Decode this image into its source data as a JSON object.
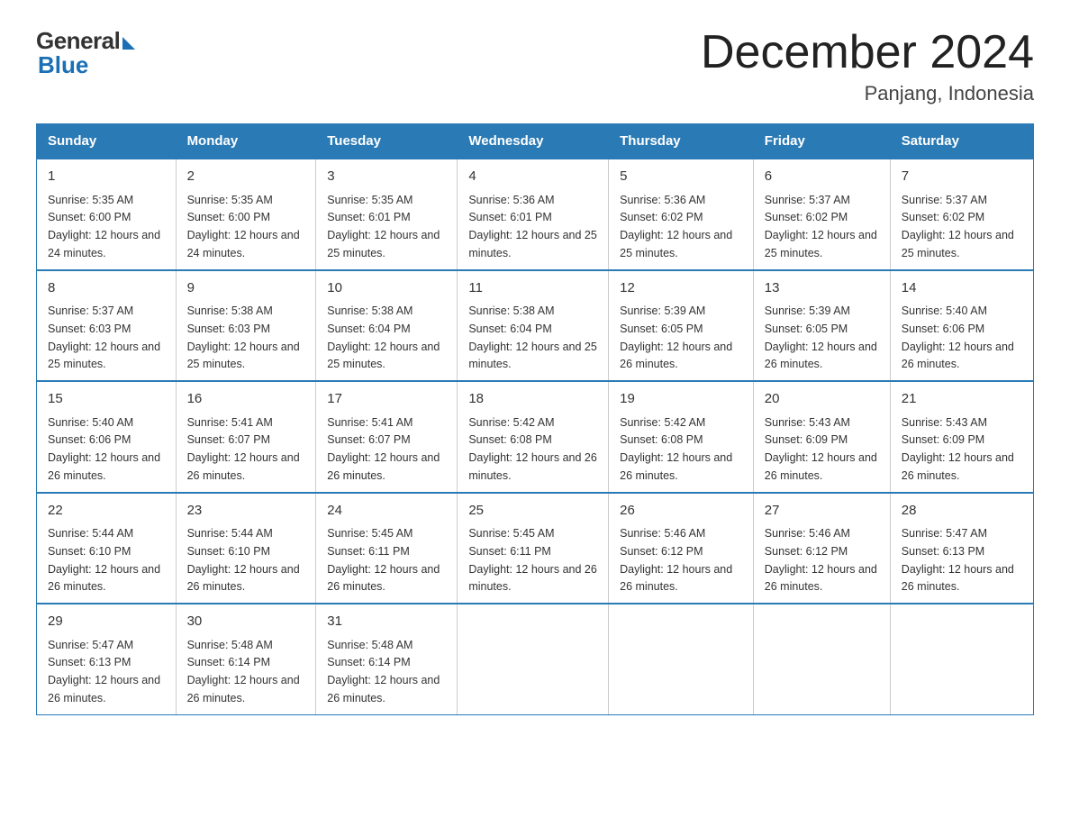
{
  "header": {
    "logo_general": "General",
    "logo_blue": "Blue",
    "main_title": "December 2024",
    "subtitle": "Panjang, Indonesia"
  },
  "days_of_week": [
    "Sunday",
    "Monday",
    "Tuesday",
    "Wednesday",
    "Thursday",
    "Friday",
    "Saturday"
  ],
  "weeks": [
    [
      {
        "day": "1",
        "sunrise": "5:35 AM",
        "sunset": "6:00 PM",
        "daylight": "12 hours and 24 minutes."
      },
      {
        "day": "2",
        "sunrise": "5:35 AM",
        "sunset": "6:00 PM",
        "daylight": "12 hours and 24 minutes."
      },
      {
        "day": "3",
        "sunrise": "5:35 AM",
        "sunset": "6:01 PM",
        "daylight": "12 hours and 25 minutes."
      },
      {
        "day": "4",
        "sunrise": "5:36 AM",
        "sunset": "6:01 PM",
        "daylight": "12 hours and 25 minutes."
      },
      {
        "day": "5",
        "sunrise": "5:36 AM",
        "sunset": "6:02 PM",
        "daylight": "12 hours and 25 minutes."
      },
      {
        "day": "6",
        "sunrise": "5:37 AM",
        "sunset": "6:02 PM",
        "daylight": "12 hours and 25 minutes."
      },
      {
        "day": "7",
        "sunrise": "5:37 AM",
        "sunset": "6:02 PM",
        "daylight": "12 hours and 25 minutes."
      }
    ],
    [
      {
        "day": "8",
        "sunrise": "5:37 AM",
        "sunset": "6:03 PM",
        "daylight": "12 hours and 25 minutes."
      },
      {
        "day": "9",
        "sunrise": "5:38 AM",
        "sunset": "6:03 PM",
        "daylight": "12 hours and 25 minutes."
      },
      {
        "day": "10",
        "sunrise": "5:38 AM",
        "sunset": "6:04 PM",
        "daylight": "12 hours and 25 minutes."
      },
      {
        "day": "11",
        "sunrise": "5:38 AM",
        "sunset": "6:04 PM",
        "daylight": "12 hours and 25 minutes."
      },
      {
        "day": "12",
        "sunrise": "5:39 AM",
        "sunset": "6:05 PM",
        "daylight": "12 hours and 26 minutes."
      },
      {
        "day": "13",
        "sunrise": "5:39 AM",
        "sunset": "6:05 PM",
        "daylight": "12 hours and 26 minutes."
      },
      {
        "day": "14",
        "sunrise": "5:40 AM",
        "sunset": "6:06 PM",
        "daylight": "12 hours and 26 minutes."
      }
    ],
    [
      {
        "day": "15",
        "sunrise": "5:40 AM",
        "sunset": "6:06 PM",
        "daylight": "12 hours and 26 minutes."
      },
      {
        "day": "16",
        "sunrise": "5:41 AM",
        "sunset": "6:07 PM",
        "daylight": "12 hours and 26 minutes."
      },
      {
        "day": "17",
        "sunrise": "5:41 AM",
        "sunset": "6:07 PM",
        "daylight": "12 hours and 26 minutes."
      },
      {
        "day": "18",
        "sunrise": "5:42 AM",
        "sunset": "6:08 PM",
        "daylight": "12 hours and 26 minutes."
      },
      {
        "day": "19",
        "sunrise": "5:42 AM",
        "sunset": "6:08 PM",
        "daylight": "12 hours and 26 minutes."
      },
      {
        "day": "20",
        "sunrise": "5:43 AM",
        "sunset": "6:09 PM",
        "daylight": "12 hours and 26 minutes."
      },
      {
        "day": "21",
        "sunrise": "5:43 AM",
        "sunset": "6:09 PM",
        "daylight": "12 hours and 26 minutes."
      }
    ],
    [
      {
        "day": "22",
        "sunrise": "5:44 AM",
        "sunset": "6:10 PM",
        "daylight": "12 hours and 26 minutes."
      },
      {
        "day": "23",
        "sunrise": "5:44 AM",
        "sunset": "6:10 PM",
        "daylight": "12 hours and 26 minutes."
      },
      {
        "day": "24",
        "sunrise": "5:45 AM",
        "sunset": "6:11 PM",
        "daylight": "12 hours and 26 minutes."
      },
      {
        "day": "25",
        "sunrise": "5:45 AM",
        "sunset": "6:11 PM",
        "daylight": "12 hours and 26 minutes."
      },
      {
        "day": "26",
        "sunrise": "5:46 AM",
        "sunset": "6:12 PM",
        "daylight": "12 hours and 26 minutes."
      },
      {
        "day": "27",
        "sunrise": "5:46 AM",
        "sunset": "6:12 PM",
        "daylight": "12 hours and 26 minutes."
      },
      {
        "day": "28",
        "sunrise": "5:47 AM",
        "sunset": "6:13 PM",
        "daylight": "12 hours and 26 minutes."
      }
    ],
    [
      {
        "day": "29",
        "sunrise": "5:47 AM",
        "sunset": "6:13 PM",
        "daylight": "12 hours and 26 minutes."
      },
      {
        "day": "30",
        "sunrise": "5:48 AM",
        "sunset": "6:14 PM",
        "daylight": "12 hours and 26 minutes."
      },
      {
        "day": "31",
        "sunrise": "5:48 AM",
        "sunset": "6:14 PM",
        "daylight": "12 hours and 26 minutes."
      },
      null,
      null,
      null,
      null
    ]
  ],
  "labels": {
    "sunrise_prefix": "Sunrise: ",
    "sunset_prefix": "Sunset: ",
    "daylight_prefix": "Daylight: "
  }
}
